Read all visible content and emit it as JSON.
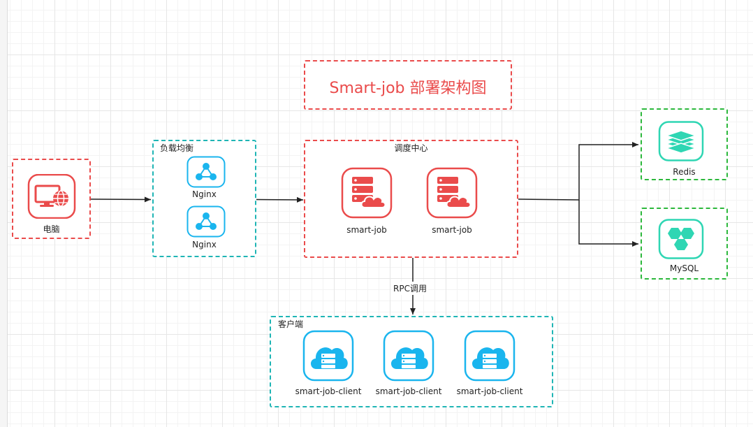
{
  "title": "Smart-job 部署架构图",
  "computer": {
    "label": "电脑"
  },
  "load_balancer": {
    "label": "负载均衡",
    "nodes": [
      "Nginx",
      "Nginx"
    ]
  },
  "scheduler": {
    "label": "调度中心",
    "nodes": [
      "smart-job",
      "smart-job"
    ]
  },
  "clients": {
    "label": "客户端",
    "nodes": [
      "smart-job-client",
      "smart-job-client",
      "smart-job-client"
    ]
  },
  "storage": {
    "redis": "Redis",
    "mysql": "MySQL"
  },
  "edges": {
    "rpc_label": "RPC调用"
  },
  "icons": {
    "computer": "computer-globe-icon",
    "nginx": "network-hub-icon",
    "scheduler": "server-cloud-icon",
    "client": "cloud-server-icon",
    "redis": "redis-stack-icon",
    "mysql": "mysql-hexagons-icon"
  },
  "colors": {
    "red": "#ea4b4b",
    "teal": "#1fb5b5",
    "green": "#2cb83c",
    "mint": "#2fd6b3",
    "blue": "#1ab5ee"
  }
}
